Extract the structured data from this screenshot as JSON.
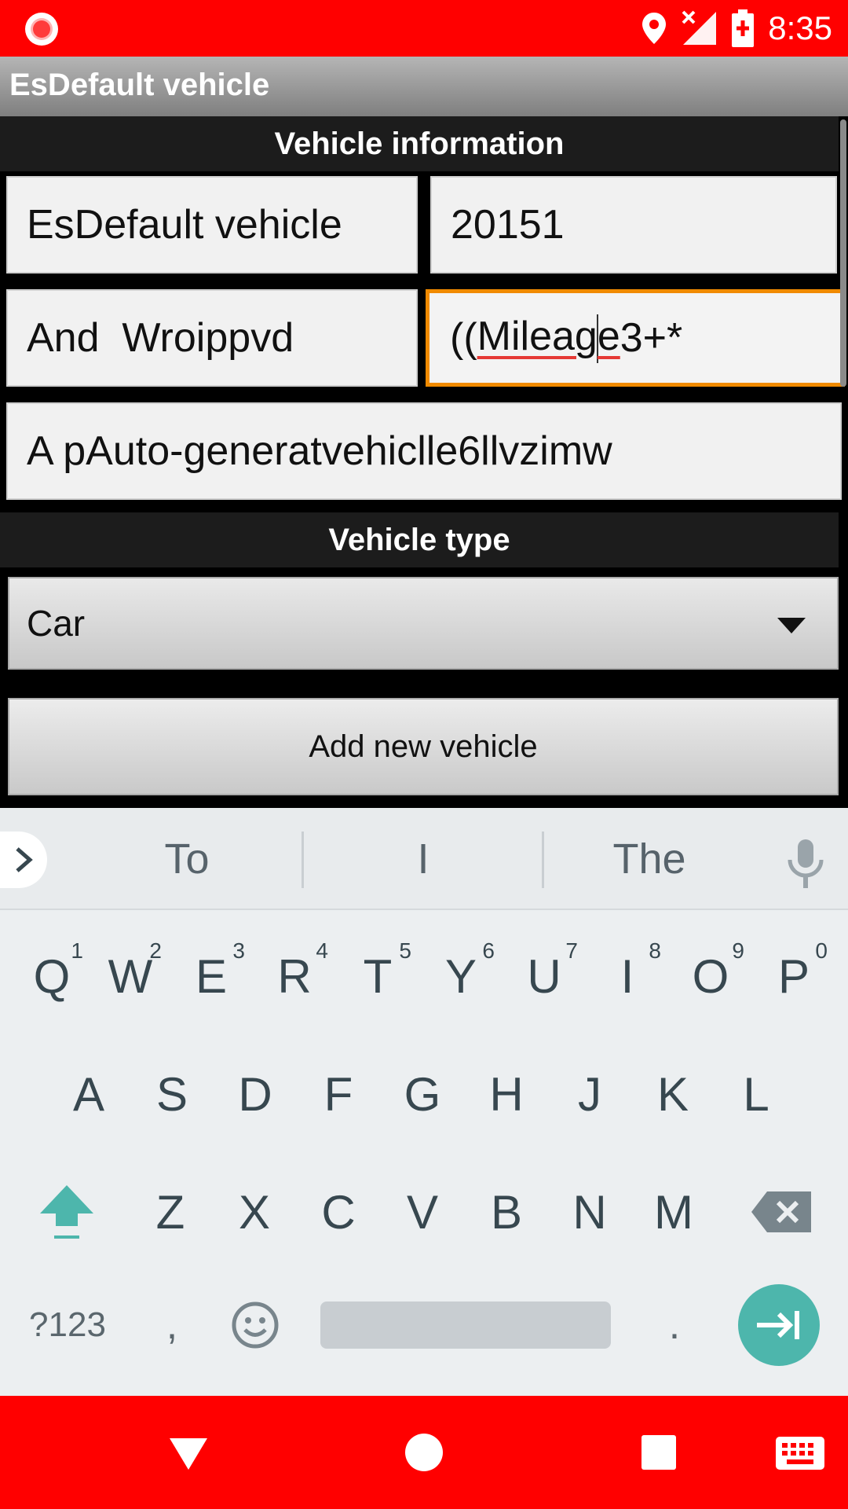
{
  "status_bar": {
    "time": "8:35",
    "icons": [
      "record-icon",
      "location-icon",
      "signal-off-icon",
      "battery-charging-icon"
    ]
  },
  "app": {
    "title": "EsDefault vehicle"
  },
  "vehicle_info": {
    "header": "Vehicle information",
    "name_value": "EsDefault vehicle",
    "year_value": "20151",
    "make_value": "And  Wroippvd",
    "mileage_prefix": "((",
    "mileage_word_a": "Mileag",
    "mileage_word_b": "e",
    "mileage_suffix": "3+*",
    "description_value": "A pAuto-generatvehiclle6llvzimw"
  },
  "vehicle_type": {
    "header": "Vehicle type",
    "selected": "Car"
  },
  "add_button": {
    "label": "Add new vehicle"
  },
  "keyboard": {
    "suggestions": [
      "To",
      "I",
      "The"
    ],
    "row1": [
      {
        "k": "Q",
        "h": "1"
      },
      {
        "k": "W",
        "h": "2"
      },
      {
        "k": "E",
        "h": "3"
      },
      {
        "k": "R",
        "h": "4"
      },
      {
        "k": "T",
        "h": "5"
      },
      {
        "k": "Y",
        "h": "6"
      },
      {
        "k": "U",
        "h": "7"
      },
      {
        "k": "I",
        "h": "8"
      },
      {
        "k": "O",
        "h": "9"
      },
      {
        "k": "P",
        "h": "0"
      }
    ],
    "row2": [
      "A",
      "S",
      "D",
      "F",
      "G",
      "H",
      "J",
      "K",
      "L"
    ],
    "row3": [
      "Z",
      "X",
      "C",
      "V",
      "B",
      "N",
      "M"
    ],
    "symbols_key": "?123",
    "comma_key": ",",
    "period_key": ".",
    "accent_color": "#4db6ac"
  },
  "colors": {
    "status_bar": "#ff0000",
    "focus_border": "#f08a00"
  }
}
